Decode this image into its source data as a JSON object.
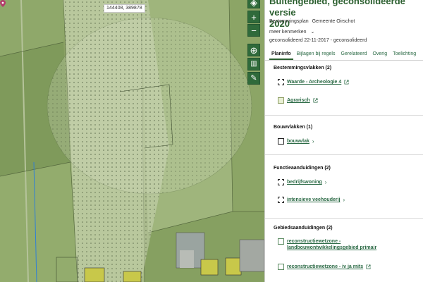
{
  "map": {
    "coordinates": "144408, 389878",
    "colors": {
      "base": "#8aa164",
      "field_light": "#b7c79a",
      "field_mid": "#a8bd84",
      "buffer_zone": "#c2ceab",
      "agrarisch_yellow": "#c8c84a",
      "road": "#b0b890",
      "water_line": "#2f7fd6"
    },
    "controls": [
      {
        "name": "layers-icon",
        "glyph": "◈"
      },
      {
        "name": "zoom-in-icon",
        "glyph": "+"
      },
      {
        "name": "zoom-out-icon",
        "glyph": "−"
      },
      {
        "name": "locate-icon",
        "glyph": "⊕"
      },
      {
        "name": "measure-icon",
        "glyph": "▥"
      },
      {
        "name": "draw-icon",
        "glyph": "✎"
      }
    ]
  },
  "panel": {
    "title": "Buitengebied, geconsolideerde versie\n2020",
    "plan_type": "Bestemmingsplan",
    "municipality": "Gemeente Oirschot",
    "meer_label": "meer kenmerken",
    "status": "geconsolideerd 22-11-2017 - geconsolideerd",
    "accent_color": "#2b5f2f",
    "tabs": [
      "Planinfo",
      "Bijlagen bij regels",
      "Gerelateerd",
      "Overig",
      "Toelichting"
    ],
    "sections": {
      "bestemmingsvlakken": {
        "title": "Bestemmingsvlakken (2)",
        "items": [
          "Waarde - Archeologie 4",
          "Agrarisch"
        ]
      },
      "bouwvlakken": {
        "title": "Bouwvlakken (1)",
        "items": [
          "bouwvlak"
        ]
      },
      "functieaanduidingen": {
        "title": "Functieaanduidingen (2)",
        "items": [
          "bedrijfswoning",
          "intensieve veehouderij"
        ]
      },
      "gebiedsaanduidingen": {
        "title": "Gebiedsaanduidingen (2)",
        "items": [
          "reconstructiewetzone - landbouwontwikkelingsgebied primair",
          "reconstructiewetzone - iv ja mits"
        ]
      }
    }
  }
}
